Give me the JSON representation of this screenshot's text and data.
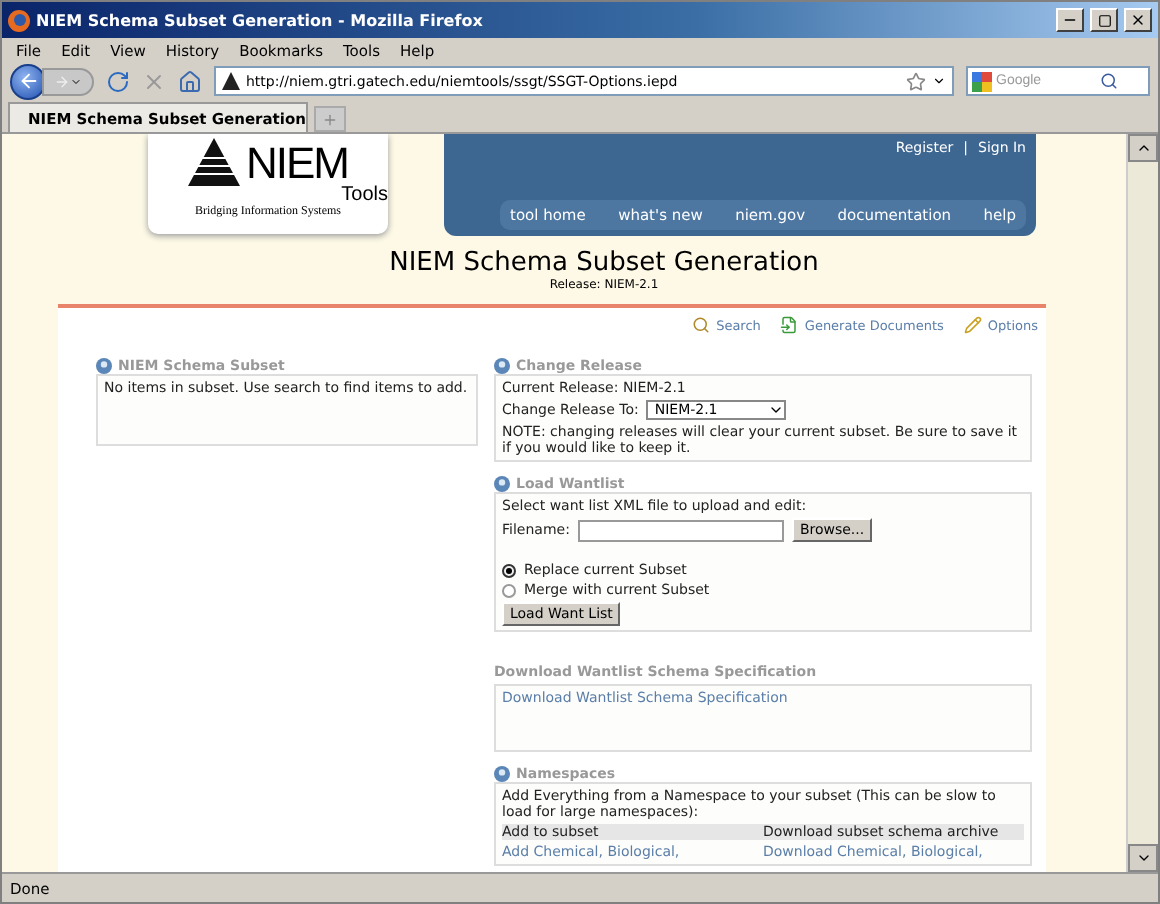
{
  "window": {
    "title": "NIEM Schema Subset Generation - Mozilla Firefox"
  },
  "menu_bar": [
    "File",
    "Edit",
    "View",
    "History",
    "Bookmarks",
    "Tools",
    "Help"
  ],
  "toolbar": {
    "url": "http://niem.gtri.gatech.edu/niemtools/ssgt/SSGT-Options.iepd",
    "search_placeholder": "Google"
  },
  "tabs": [
    {
      "label": "NIEM Schema Subset Generation",
      "selected": true
    }
  ],
  "page": {
    "logo": {
      "name": "NIEM",
      "tools": "Tools",
      "tagline": "Bridging Information Systems"
    },
    "top_links": [
      "Register",
      "Sign In"
    ],
    "top_links_separator": "|",
    "nav": [
      "tool home",
      "what's new",
      "niem.gov",
      "documentation",
      "help"
    ],
    "title": "NIEM Schema Subset Generation",
    "release": "Release: NIEM-2.1",
    "actions": [
      {
        "kind": "search",
        "label": "Search"
      },
      {
        "kind": "generate",
        "label": "Generate Documents"
      },
      {
        "kind": "options",
        "label": "Options"
      }
    ],
    "subset": {
      "heading": "NIEM Schema Subset",
      "text": "No items in subset. Use search to find items to add."
    },
    "change_release": {
      "heading": "Change Release",
      "current": "Current Release: NIEM-2.1",
      "change_label": "Change Release To:",
      "select_value": "NIEM-2.1",
      "note": "NOTE: changing releases will clear your current subset. Be sure to save it if you would like to keep it."
    },
    "load_wantlist": {
      "heading": "Load Wantlist",
      "instruction": "Select want list XML file to upload and edit:",
      "filename_label": "Filename:",
      "browse": "Browse...",
      "options": [
        {
          "label": "Replace current Subset",
          "selected": true
        },
        {
          "label": "Merge with current Subset",
          "selected": false
        }
      ],
      "button": "Load Want List"
    },
    "download_spec": {
      "heading": "Download Wantlist Schema Specification",
      "link": "Download Wantlist Schema Specification"
    },
    "namespaces": {
      "heading": "Namespaces",
      "text": "Add Everything from a Namespace to your subset (This can be slow to load for large namespaces):",
      "columns": [
        "Add to subset",
        "Download subset schema archive"
      ],
      "rows": [
        [
          "Add Chemical, Biological,",
          "Download Chemical, Biological,"
        ]
      ]
    }
  },
  "status_bar": {
    "text": "Done"
  }
}
